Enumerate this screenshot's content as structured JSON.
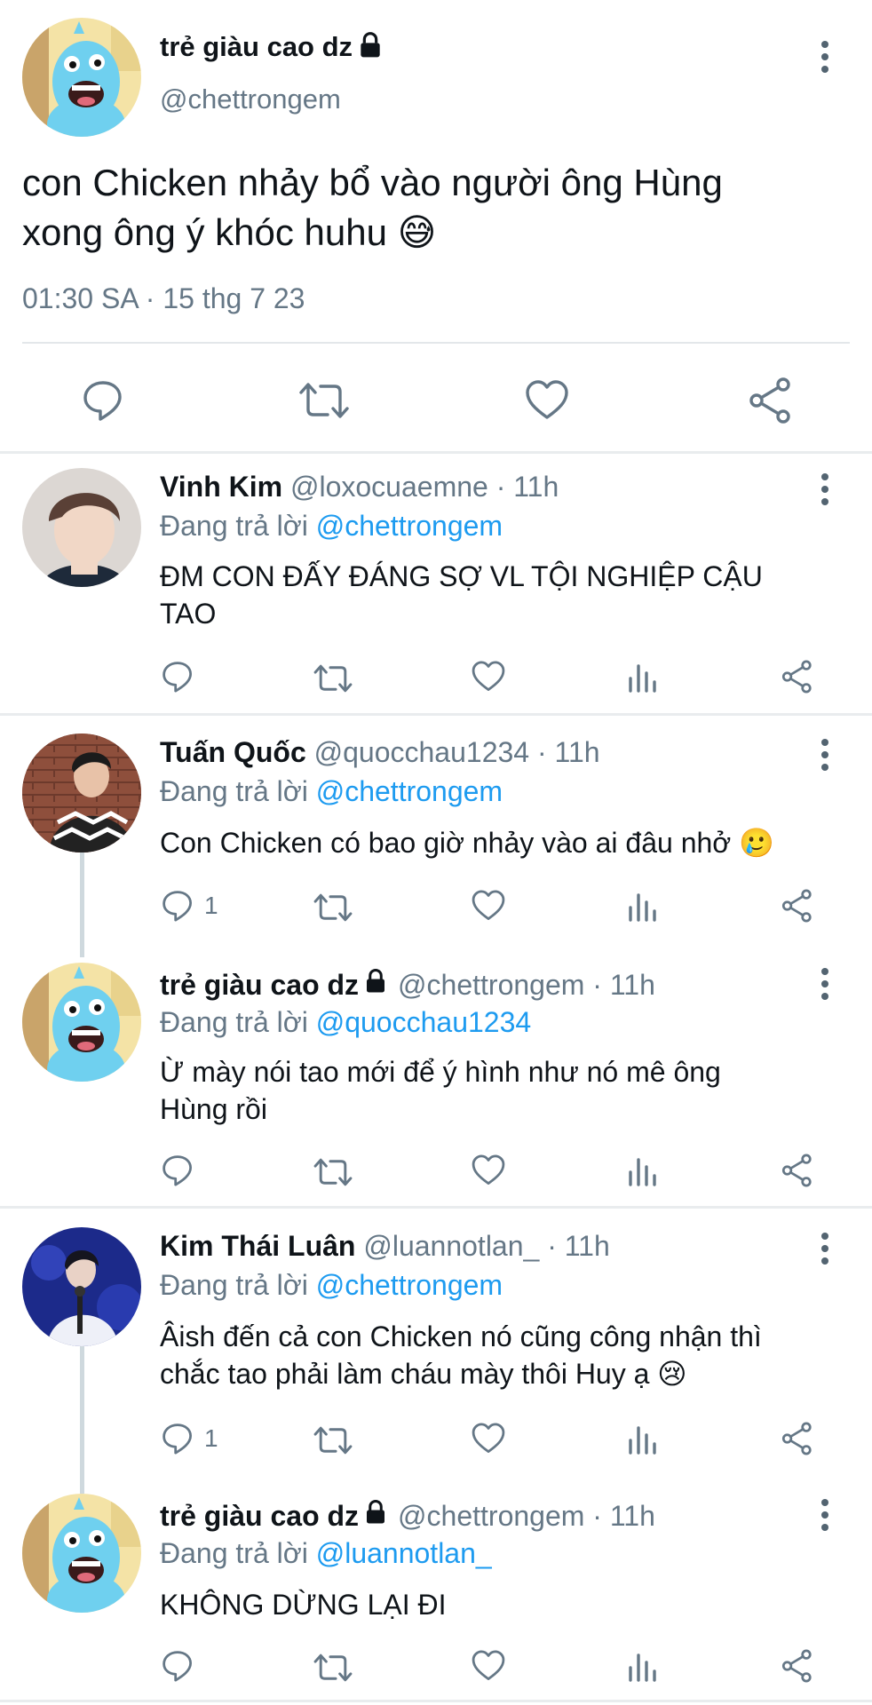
{
  "main_tweet": {
    "display_name": "trẻ giàu cao dz",
    "handle": "@chettrongem",
    "text_line1": "con Chicken nhảy bổ vào người ông Hùng",
    "text_line2": "xong ông ý khóc huhu",
    "emoji": "😅",
    "timestamp": "01:30 SA · 15 thg 7 23",
    "icons": [
      "reply-icon",
      "retweet-icon",
      "like-icon",
      "share-icon"
    ]
  },
  "replies": [
    {
      "display_name": "Vinh Kim",
      "handle_time": "@loxocuaemne · 11h",
      "replying_prefix": "Đang trả lời",
      "replying_to": "@chettrongem",
      "text_line1": "ĐM CON ĐẤY ĐÁNG SỢ VL TỘI NGHIỆP CẬU",
      "text_line2": "TAO",
      "reply_count": ""
    },
    {
      "display_name": "Tuấn Quốc",
      "handle_time": "@quocchau1234 · 11h",
      "replying_prefix": "Đang trả lời",
      "replying_to": "@chettrongem",
      "text_line1": "Con Chicken có bao giờ nhảy vào ai đâu nhở",
      "emoji": "🥲",
      "reply_count": "1"
    },
    {
      "display_name": "trẻ giàu cao dz",
      "handle_time": "@chettrongem · 11h",
      "replying_prefix": "Đang trả lời",
      "replying_to": "@quocchau1234",
      "text_line1": "Ừ mày nói tao mới để ý hình như nó mê ông",
      "text_line2": "Hùng rồi",
      "reply_count": ""
    },
    {
      "display_name": "Kim Thái Luân",
      "handle_time": "@luannotlan_ · 11h",
      "replying_prefix": "Đang trả lời",
      "replying_to": "@chettrongem",
      "text_line1": "Âish đến cả con Chicken nó cũng công nhận thì",
      "text_line2": "chắc tao phải làm cháu mày thôi Huy ạ",
      "emoji": "😢",
      "reply_count": "1"
    },
    {
      "display_name": "trẻ giàu cao dz",
      "handle_time": "@chettrongem · 11h",
      "replying_prefix": "Đang trả lời",
      "replying_to": "@luannotlan_",
      "text_line1": "KHÔNG DỪNG LẠI ĐI",
      "reply_count": ""
    }
  ],
  "colors": {
    "link": "#1d9bf0",
    "muted": "#657786",
    "text": "#0f1419",
    "separator": "#e9ecee"
  }
}
